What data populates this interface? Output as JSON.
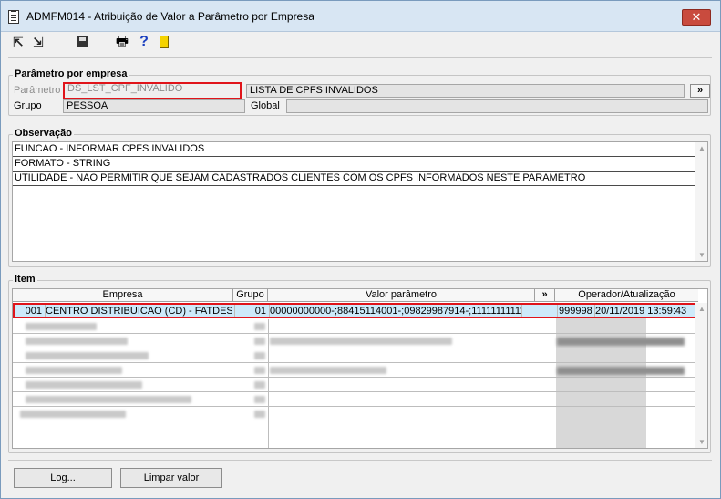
{
  "window": {
    "title": "ADMFM014 - Atribuição de Valor a Parâmetro por Empresa",
    "close_glyph": "✕"
  },
  "toolbar": {
    "first_icon": "first-record-icon",
    "last_icon": "last-record-icon",
    "save_icon": "save-icon",
    "print_icon": "printer-icon",
    "help_glyph": "?",
    "exit_icon": "exit-door-icon"
  },
  "parametro_group": {
    "label": "Parâmetro por empresa",
    "parametro_label": "Parâmetro",
    "parametro_value": "DS_LST_CPF_INVALIDO",
    "parametro_desc": "LISTA DE CPFS INVALIDOS",
    "lookup_button": "»",
    "grupo_label": "Grupo",
    "grupo_value": "PESSOA",
    "global_label": "Global",
    "global_value": ""
  },
  "observacao": {
    "label": "Observação",
    "lines": [
      "FUNCAO - INFORMAR CPFS INVALIDOS",
      "FORMATO - STRING",
      "UTILIDADE - NAO PERMITIR QUE SEJAM CADASTRADOS CLIENTES COM OS CPFS INFORMADOS NESTE PARAMETRO"
    ]
  },
  "item": {
    "label": "Item",
    "columns": {
      "empresa": "Empresa",
      "grupo": "Grupo",
      "valor": "Valor parâmetro",
      "expand": "»",
      "operador": "Operador/Atualização"
    },
    "rows": [
      {
        "codigo": "001",
        "empresa": "CENTRO DISTRIBUICAO (CD) - FATDES",
        "grupo": "01",
        "valor": "00000000000-;88415114001-;09829987914-;11111111111",
        "operador": "999998",
        "atualizacao": "20/11/2019 13:59:43"
      }
    ]
  },
  "footer": {
    "log_button": "Log...",
    "limpar_button": "Limpar valor"
  }
}
